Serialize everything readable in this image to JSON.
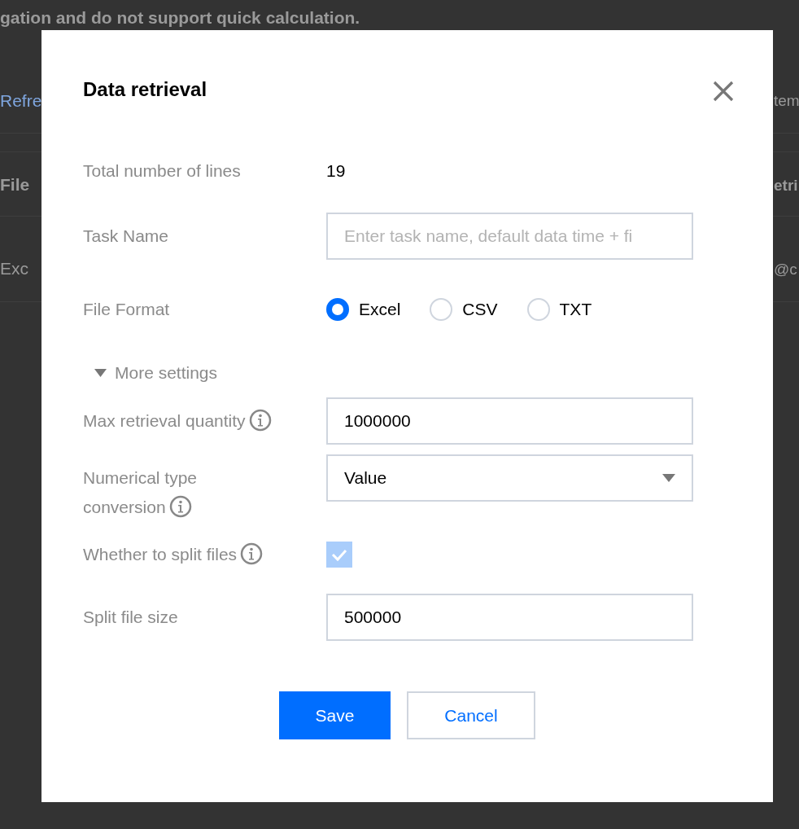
{
  "background": {
    "notice": "gation and do not support quick calculation.",
    "left_link": "Refre",
    "right_text": "tem",
    "table": {
      "columns": [
        "File",
        "etri"
      ],
      "rows": [
        [
          "Exc",
          "@c"
        ]
      ]
    }
  },
  "dialog": {
    "title": "Data retrieval",
    "rows": [
      {
        "kind": "text",
        "label": "Total number of lines",
        "value": "19"
      },
      {
        "kind": "input",
        "label": "Task Name",
        "placeholder": "Enter task name, default data time + fi"
      },
      {
        "kind": "radio",
        "label": "File Format",
        "options": [
          {
            "label": "Excel",
            "selected": true
          },
          {
            "label": "CSV",
            "selected": false
          },
          {
            "label": "TXT",
            "selected": false
          }
        ]
      },
      {
        "kind": "toggle",
        "label": "More settings",
        "expanded": true
      },
      {
        "kind": "input",
        "label": "Max retrieval quantity",
        "info": true,
        "value": "1000000"
      },
      {
        "kind": "select",
        "label": "Numerical type conversion",
        "info": true,
        "value": "Value"
      },
      {
        "kind": "checkbox",
        "label": "Whether to split files",
        "info": true,
        "checked": true,
        "disabled": true
      },
      {
        "kind": "input",
        "label": "Split file size",
        "value": "500000"
      }
    ],
    "buttons": [
      {
        "label": "Save",
        "primary": true
      },
      {
        "label": "Cancel",
        "primary": false
      }
    ]
  }
}
